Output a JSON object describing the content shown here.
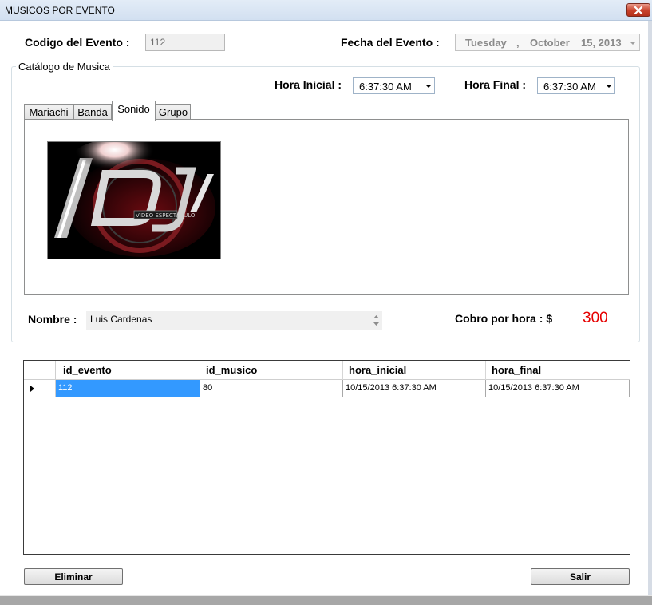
{
  "window": {
    "title": "MUSICOS POR EVENTO"
  },
  "header": {
    "codigo_label": "Codigo del Evento :",
    "codigo_value": "112",
    "fecha_label": "Fecha del Evento :",
    "fecha_day": "Tuesday",
    "fecha_sep": ",",
    "fecha_month": "October",
    "fecha_daynum": "15, 2013"
  },
  "catalogo": {
    "legend": "Catálogo de Musica",
    "hora_inicial_label": "Hora Inicial :",
    "hora_inicial_value": "6:37:30 AM",
    "hora_final_label": "Hora Final :",
    "hora_final_value": "6:37:30 AM",
    "tabs": [
      {
        "label": "Mariachi"
      },
      {
        "label": "Banda"
      },
      {
        "label": "Sonido"
      },
      {
        "label": "Grupo"
      }
    ],
    "active_tab": "Sonido",
    "image_text": {
      "logo": "DJ",
      "small": "VIDEO ESPECTACULO"
    },
    "nombre_label": "Nombre :",
    "nombre_value": "Luis Cardenas",
    "cobro_label": "Cobro por hora : $",
    "cobro_value": "300"
  },
  "grid": {
    "columns": [
      "id_evento",
      "id_musico",
      "hora_inicial",
      "hora_final"
    ],
    "rows": [
      [
        "112",
        "80",
        "10/15/2013 6:37:30 AM",
        "10/15/2013 6:37:30 AM"
      ]
    ]
  },
  "buttons": {
    "eliminar": "Eliminar",
    "salir": "Salir"
  },
  "colors": {
    "accent_red": "#e60000",
    "selection": "#3399ff"
  }
}
